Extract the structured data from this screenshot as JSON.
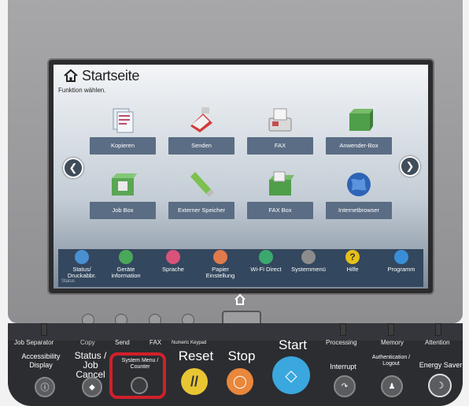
{
  "screen": {
    "title": "Startseite",
    "subtitle": "Funktion wählen.",
    "tiles": [
      {
        "label": "Kopieren",
        "icon": "copy-icon"
      },
      {
        "label": "Senden",
        "icon": "send-icon"
      },
      {
        "label": "FAX",
        "icon": "fax-icon"
      },
      {
        "label": "Anwender-Box",
        "icon": "user-box-icon"
      },
      {
        "label": "Job Box",
        "icon": "job-box-icon"
      },
      {
        "label": "Externer Speicher",
        "icon": "usb-memory-icon"
      },
      {
        "label": "FAX Box",
        "icon": "fax-box-icon"
      },
      {
        "label": "Internetbrowser",
        "icon": "globe-icon"
      }
    ],
    "tray": [
      {
        "label": "Status/ Druckabbr.",
        "color": "#4a8fd0"
      },
      {
        "label": "Geräte information",
        "color": "#4aa85a"
      },
      {
        "label": "Sprache",
        "color": "#d8527a"
      },
      {
        "label": "Papier Einstellung",
        "color": "#e07a4a"
      },
      {
        "label": "Wi-Fi Direct",
        "color": "#3ba86e"
      },
      {
        "label": "Systemmenü",
        "color": "#8c8c8c"
      },
      {
        "label": "Hilfe",
        "color": "#e6c018"
      },
      {
        "label": "Programm",
        "color": "#3a8ed8"
      }
    ],
    "status_label": "Status"
  },
  "panel": {
    "strip": {
      "job_separator": "Job Separator",
      "copy": "Copy",
      "send": "Send",
      "fax": "FAX",
      "numeric_keypad": "Numeric Keypad",
      "processing": "Processing",
      "memory": "Memory",
      "attention": "Attention"
    },
    "keys": {
      "accessibility": "Accessibility Display",
      "status": "Status / Job Cancel",
      "system_menu": "System Menu / Counter",
      "reset": "Reset",
      "stop": "Stop",
      "start": "Start",
      "interrupt": "Interrupt",
      "auth": "Authentication / Logout",
      "energy": "Energy Saver"
    },
    "colors": {
      "reset": "#e8c633",
      "stop": "#e9873b",
      "start": "#3aa7de",
      "highlight": "#d0202b"
    }
  }
}
